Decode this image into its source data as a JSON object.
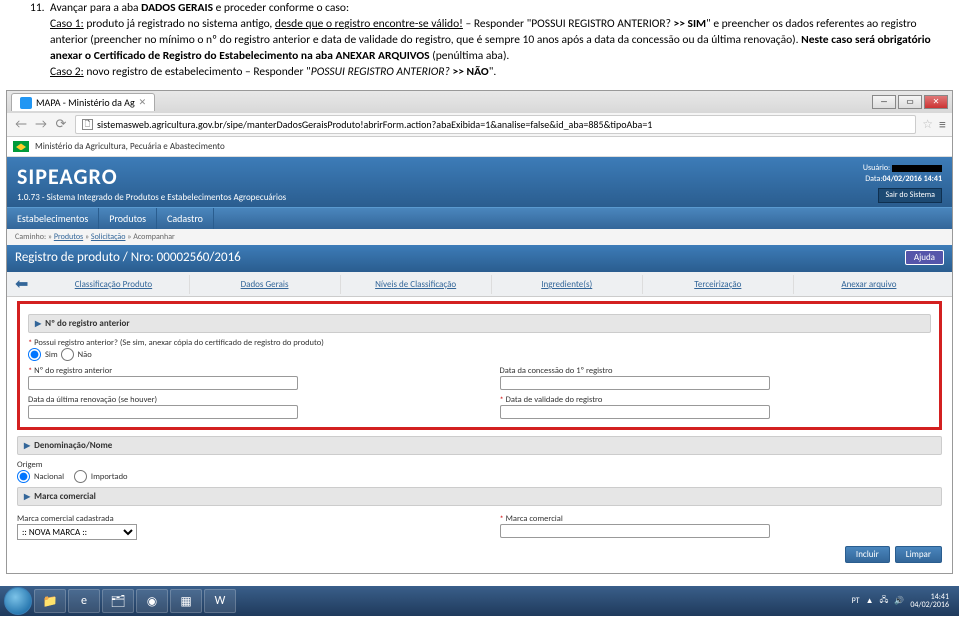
{
  "instruction": {
    "number": "11.",
    "intro": "Avançar para a aba ",
    "bold1": "DADOS GERAIS",
    "intro2": " e proceder conforme o caso:",
    "caso1_label": "Caso 1:",
    "caso1_a": " produto já registrado no sistema antigo, ",
    "caso1_u": "desde que o registro encontre-se válido!",
    "caso1_b": " – Responder \"POSSUI REGISTRO ANTERIOR? ",
    "bold2": ">> SIM",
    "caso1_c": "\" e preencher os dados referentes ao registro anterior (preencher no mínimo o nº do registro anterior e data de validade do registro, que é sempre 10 anos após a data da concessão ou da última renovação). ",
    "bold3": "Neste caso será obrigatório anexar o Certificado de Registro do Estabelecimento na aba ANEXAR ARQUIVOS",
    "caso1_d": " (penúltima aba).",
    "caso2_label": "Caso 2:",
    "caso2_a": " novo registro de estabelecimento – Responder \"",
    "caso2_i": "POSSUI REGISTRO ANTERIOR? ",
    "bold4": ">> NÃO",
    "caso2_b": "\"."
  },
  "browser": {
    "tab_title": "MAPA - Ministério da Ag",
    "url": "sistemasweb.agricultura.gov.br/sipe/manterDadosGeraisProduto!abrirForm.action?abaExibida=1&analise=false&id_aba=885&tipoAba=1"
  },
  "gov_bar": "Ministério da Agricultura, Pecuária e Abastecimento",
  "app": {
    "title": "SIPEAGRO",
    "subtitle": "1.0.73 - Sistema Integrado de Produtos e Estabelecimentos Agropecuários",
    "user_label": "Usuário:",
    "date_label": "Data:",
    "date_value": "04/02/2016 14:41",
    "logout": "Sair do Sistema"
  },
  "menu": {
    "m1": "Estabelecimentos",
    "m2": "Produtos",
    "m3": "Cadastro"
  },
  "crumb": {
    "c1": "Caminho:",
    "c2": "Produtos",
    "c3": "Solicitação",
    "c4": "Acompanhar"
  },
  "page_title": "Registro de produto / Nro: 00002560/2016",
  "help": "Ajuda",
  "tabs": {
    "t1": "Classificação Produto",
    "t2": "Dados Gerais",
    "t3": "Níveis de Classificação",
    "t4": "Ingrediente(s)",
    "t5": "Terceirização",
    "t6": "Anexar arquivo"
  },
  "form": {
    "sec_registro": "Nº do registro anterior",
    "q_possui": "Possui registro anterior? (Se sim, anexar cópia do certificado de registro do produto)",
    "sim": "Sim",
    "nao": "Não",
    "l_nregistro": "Nº do registro anterior",
    "l_dataconc": "Data da concessão do 1º registro",
    "l_dataren": "Data da última renovação (se houver)",
    "l_datavalid": "Data de validade do registro",
    "sec_denom": "Denominação/Nome",
    "l_origem": "Origem",
    "nacional": "Nacional",
    "importado": "Importado",
    "sec_marca": "Marca comercial",
    "l_marcacad": "Marca comercial cadastrada",
    "l_marcacom": "Marca comercial",
    "sel_marca": ":: NOVA MARCA ::",
    "btn_incluir": "Incluir",
    "btn_limpar": "Limpar"
  },
  "tray": {
    "lang": "PT",
    "time": "14:41",
    "date": "04/02/2016"
  }
}
